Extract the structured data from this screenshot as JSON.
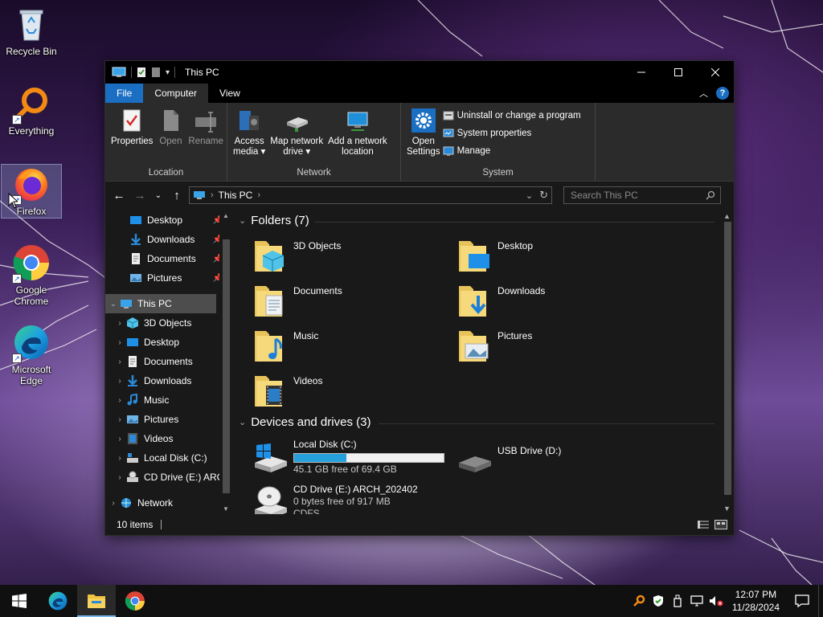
{
  "desktop": {
    "icons": [
      {
        "label": "Recycle Bin",
        "icon": "recycle-bin-icon"
      },
      {
        "label": "Everything",
        "icon": "everything-search-icon"
      },
      {
        "label": "Firefox",
        "icon": "firefox-icon"
      },
      {
        "label": "Google Chrome",
        "icon": "chrome-icon"
      },
      {
        "label": "Microsoft Edge",
        "icon": "edge-icon"
      }
    ]
  },
  "window": {
    "title": "This PC",
    "tabs": {
      "file": "File",
      "computer": "Computer",
      "view": "View"
    },
    "ribbon": {
      "location": {
        "label": "Location",
        "properties": "Properties",
        "open": "Open",
        "rename": "Rename"
      },
      "network": {
        "label": "Network",
        "access_media_1": "Access",
        "access_media_2": "media ▾",
        "map_drive_1": "Map network",
        "map_drive_2": "drive ▾",
        "add_location_1": "Add a network",
        "add_location_2": "location"
      },
      "system": {
        "label": "System",
        "open_settings_1": "Open",
        "open_settings_2": "Settings",
        "uninstall": "Uninstall or change a program",
        "system_properties": "System properties",
        "manage": "Manage"
      }
    },
    "address": {
      "path": "This PC",
      "search_placeholder": "Search This PC"
    },
    "nav_pane": {
      "quick_access": [
        {
          "label": "Desktop",
          "icon": "desktop-folder-icon",
          "pinned": true
        },
        {
          "label": "Downloads",
          "icon": "downloads-folder-icon",
          "pinned": true
        },
        {
          "label": "Documents",
          "icon": "documents-folder-icon",
          "pinned": true
        },
        {
          "label": "Pictures",
          "icon": "pictures-folder-icon",
          "pinned": true
        }
      ],
      "this_pc": "This PC",
      "this_pc_children": [
        {
          "label": "3D Objects",
          "icon": "3d-objects-icon"
        },
        {
          "label": "Desktop",
          "icon": "desktop-folder-icon"
        },
        {
          "label": "Documents",
          "icon": "documents-folder-icon"
        },
        {
          "label": "Downloads",
          "icon": "downloads-folder-icon"
        },
        {
          "label": "Music",
          "icon": "music-folder-icon"
        },
        {
          "label": "Pictures",
          "icon": "pictures-folder-icon"
        },
        {
          "label": "Videos",
          "icon": "videos-folder-icon"
        },
        {
          "label": "Local Disk (C:)",
          "icon": "local-disk-icon"
        },
        {
          "label": "CD Drive (E:) ARC",
          "icon": "cd-drive-icon"
        }
      ],
      "network": "Network"
    },
    "content": {
      "folders_header": "Folders (7)",
      "folders": [
        {
          "label": "3D Objects",
          "icon": "3d-objects-folder-icon"
        },
        {
          "label": "Desktop",
          "icon": "desktop-folder-icon"
        },
        {
          "label": "Documents",
          "icon": "documents-folder-icon"
        },
        {
          "label": "Downloads",
          "icon": "downloads-folder-icon"
        },
        {
          "label": "Music",
          "icon": "music-folder-icon"
        },
        {
          "label": "Pictures",
          "icon": "pictures-folder-icon"
        },
        {
          "label": "Videos",
          "icon": "videos-folder-icon"
        }
      ],
      "drives_header": "Devices and drives (3)",
      "drives": [
        {
          "label": "Local Disk (C:)",
          "free": "45.1 GB free of 69.4 GB",
          "used_fraction": 0.35,
          "icon": "windows-drive-icon"
        },
        {
          "label": "USB Drive (D:)",
          "icon": "usb-drive-icon"
        },
        {
          "label": "CD Drive (E:) ARCH_202402",
          "free": "0 bytes free of 917 MB",
          "fs": "CDFS",
          "icon": "cd-drive-icon"
        }
      ]
    },
    "status": {
      "items": "10 items"
    }
  },
  "taskbar": {
    "apps": [
      "start-icon",
      "edge-icon",
      "file-explorer-icon",
      "chrome-icon"
    ],
    "time": "12:07 PM",
    "date": "11/28/2024"
  },
  "colors": {
    "accent": "#1a6fc2",
    "progress": "#26a0da",
    "window_bg": "#191919",
    "ribbon_bg": "#2b2b2b"
  }
}
